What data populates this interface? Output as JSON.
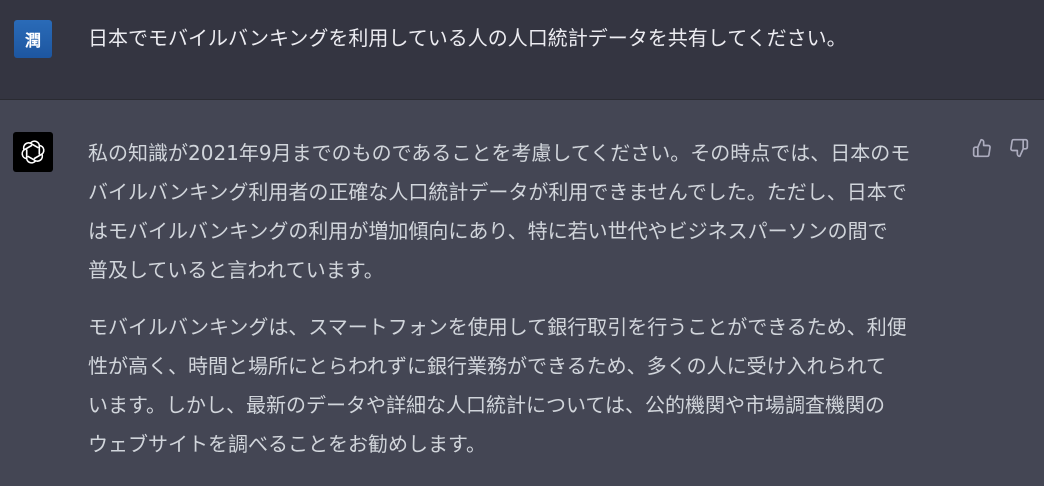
{
  "user_message": {
    "avatar_label": "潤",
    "text": "日本でモバイルバンキングを利用している人の人口統計データを共有してください。"
  },
  "assistant_message": {
    "paragraphs": [
      {
        "lines": [
          "私の知識が2021年9月までのものであることを考慮してください。その時点では、日本のモ",
          "バイルバンキング利用者の正確な人口統計データが利用できませんでした。ただし、日本で",
          "はモバイルバンキングの利用が増加傾向にあり、特に若い世代やビジネスパーソンの間で",
          "普及していると言われています。"
        ]
      },
      {
        "lines": [
          "モバイルバンキングは、スマートフォンを使用して銀行取引を行うことができるため、利便",
          "性が高く、時間と場所にとらわれずに銀行業務ができるため、多くの人に受け入れられて",
          "います。しかし、最新のデータや詳細な人口統計については、公的機関や市場調査機関の",
          "ウェブサイトを調べることをお勧めします。"
        ]
      }
    ]
  },
  "icons": {
    "assistant_avatar": "openai-logo-icon",
    "like": "thumbs-up-icon",
    "dislike": "thumbs-down-icon"
  },
  "colors": {
    "user_bg": "#343541",
    "assistant_bg": "#444654",
    "user_avatar": "#1d56a0",
    "text": "#d1d5db"
  }
}
